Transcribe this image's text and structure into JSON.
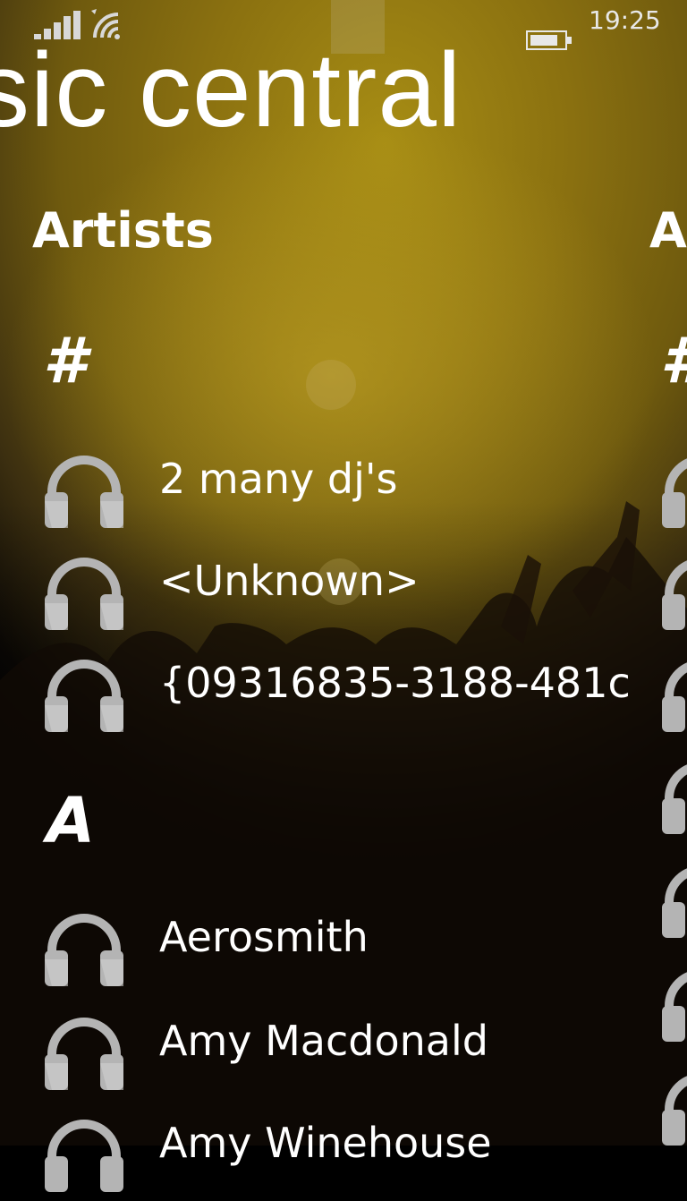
{
  "status_bar": {
    "time": "19:25",
    "icons": [
      "signal-icon",
      "wifi-icon",
      "battery-icon"
    ]
  },
  "app": {
    "title": "sic central"
  },
  "sections": [
    {
      "header": "Artists",
      "groups": [
        {
          "letter": "#",
          "items": [
            "2 many dj's",
            "<Unknown>",
            "{09316835-3188-481c"
          ]
        },
        {
          "letter": "A",
          "items": [
            "Aerosmith",
            "Amy Macdonald",
            "Amy Winehouse"
          ]
        }
      ]
    },
    {
      "header": "A",
      "group_letter": "#"
    }
  ],
  "colors": {
    "background_warm": "#a78d14",
    "text": "#ffffff",
    "icon_gray": "#b4b4b4"
  }
}
